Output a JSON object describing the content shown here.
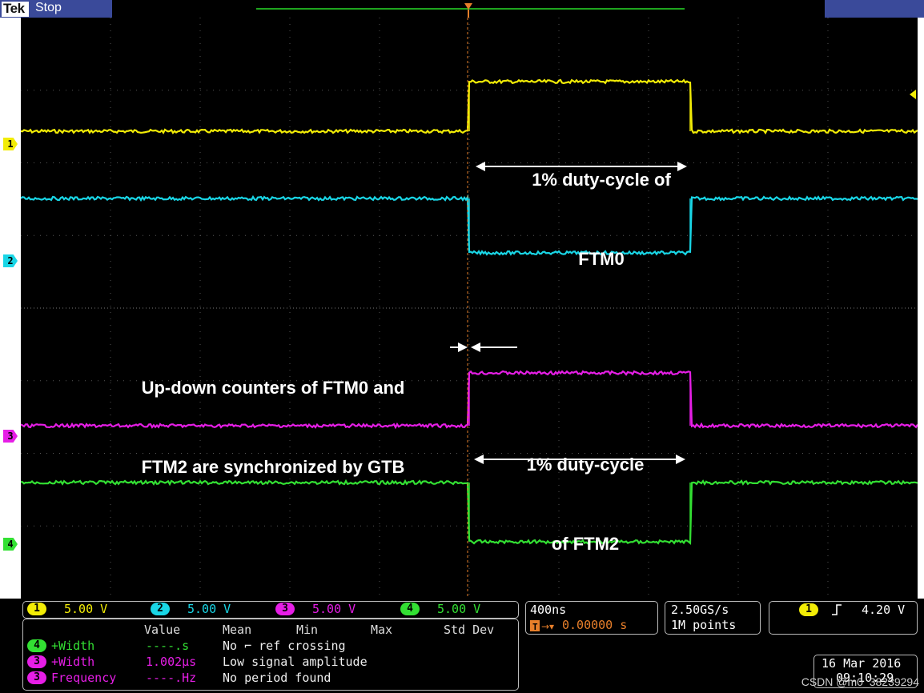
{
  "header": {
    "brand": "Tek",
    "status": "Stop",
    "trigger_marker": "T"
  },
  "channels": [
    {
      "num": "1",
      "color": "#f2ec06",
      "scale": "5.00 V"
    },
    {
      "num": "2",
      "color": "#19d6e6",
      "scale": "5.00 V"
    },
    {
      "num": "3",
      "color": "#e61ee6",
      "scale": "5.00 V"
    },
    {
      "num": "4",
      "color": "#33e033",
      "scale": "5.00 V"
    }
  ],
  "annotations": {
    "ftm0_duty_line1": "1% duty-cycle of",
    "ftm0_duty_line2": "FTM0",
    "sync_line1": "Up-down counters of FTM0 and",
    "sync_line2": "FTM2 are synchronized by GTB",
    "ftm2_duty_line1": "1% duty-cycle",
    "ftm2_duty_line2": "of FTM2"
  },
  "timebase": {
    "scale": "400ns",
    "position": "0.00000 s"
  },
  "acquisition": {
    "rate": "2.50GS/s",
    "record": "1M points"
  },
  "trigger": {
    "source": "1",
    "slope": "rising",
    "level": "4.20 V"
  },
  "measurements": {
    "headers": [
      "Value",
      "Mean",
      "Min",
      "Max",
      "Std Dev"
    ],
    "rows": [
      {
        "source": "4",
        "name": "+Width",
        "value": "----.s",
        "note": "No ⌐ ref crossing"
      },
      {
        "source": "3",
        "name": "+Width",
        "value": "1.002µs",
        "note": "Low signal amplitude"
      },
      {
        "source": "3",
        "name": "Frequency",
        "value": "----.Hz",
        "note": "No period found"
      }
    ]
  },
  "datetime": {
    "date": "16 Mar 2016",
    "time": "09:10:29"
  },
  "watermark": "CSDN @m0_38239294"
}
